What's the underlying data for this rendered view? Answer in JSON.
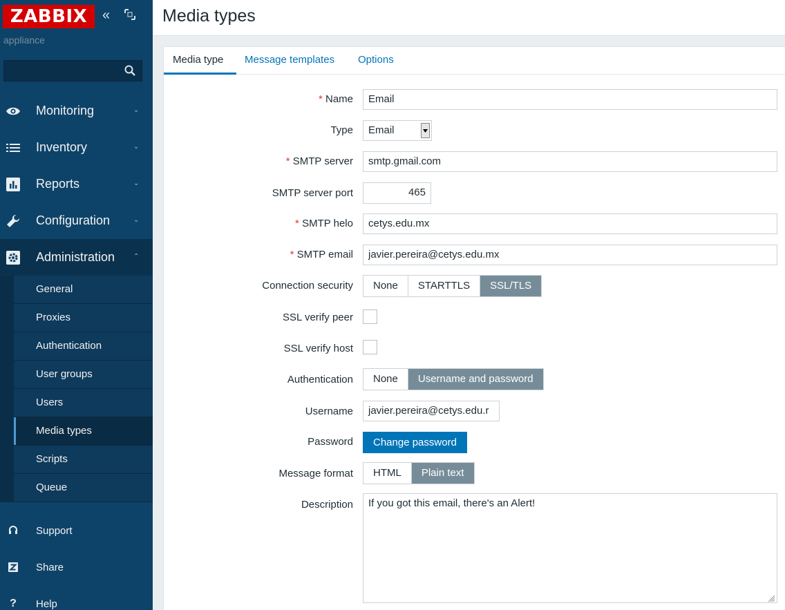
{
  "sidebar": {
    "logo": "ZABBIX",
    "subtitle": "appliance",
    "search": {
      "value": "",
      "placeholder": ""
    },
    "menu": [
      {
        "label": "Monitoring",
        "icon": "eye-icon"
      },
      {
        "label": "Inventory",
        "icon": "list-icon"
      },
      {
        "label": "Reports",
        "icon": "bar-chart-icon"
      },
      {
        "label": "Configuration",
        "icon": "wrench-icon"
      },
      {
        "label": "Administration",
        "icon": "gear-icon"
      }
    ],
    "admin_submenu": [
      "General",
      "Proxies",
      "Authentication",
      "User groups",
      "Users",
      "Media types",
      "Scripts",
      "Queue"
    ],
    "selected_submenu": "Media types",
    "bottom": [
      {
        "label": "Support",
        "icon": "headset-icon"
      },
      {
        "label": "Share",
        "icon": "share-icon"
      },
      {
        "label": "Help",
        "icon": "help-icon"
      }
    ]
  },
  "header": {
    "title": "Media types"
  },
  "tabs": [
    "Media type",
    "Message templates",
    "Options"
  ],
  "form": {
    "name": {
      "label": "Name",
      "value": "Email"
    },
    "type": {
      "label": "Type",
      "value": "Email"
    },
    "smtp_server": {
      "label": "SMTP server",
      "value": "smtp.gmail.com"
    },
    "smtp_port": {
      "label": "SMTP server port",
      "value": "465"
    },
    "smtp_helo": {
      "label": "SMTP helo",
      "value": "cetys.edu.mx"
    },
    "smtp_email": {
      "label": "SMTP email",
      "value": "javier.pereira@cetys.edu.mx"
    },
    "connection_security": {
      "label": "Connection security",
      "options": [
        "None",
        "STARTTLS",
        "SSL/TLS"
      ],
      "selected": "SSL/TLS"
    },
    "ssl_verify_peer": {
      "label": "SSL verify peer",
      "checked": false
    },
    "ssl_verify_host": {
      "label": "SSL verify host",
      "checked": false
    },
    "authentication": {
      "label": "Authentication",
      "options": [
        "None",
        "Username and password"
      ],
      "selected": "Username and password"
    },
    "username": {
      "label": "Username",
      "value": "javier.pereira@cetys.edu.r"
    },
    "password": {
      "label": "Password",
      "button": "Change password"
    },
    "message_format": {
      "label": "Message format",
      "options": [
        "HTML",
        "Plain text"
      ],
      "selected": "Plain text"
    },
    "description": {
      "label": "Description",
      "value": "If you got this email, there's an Alert!"
    }
  },
  "colors": {
    "sidebar_bg": "#0e4369",
    "logo_red": "#d40000",
    "accent_blue": "#0275b8",
    "segment_on": "#768d99",
    "required": "#e33734"
  }
}
